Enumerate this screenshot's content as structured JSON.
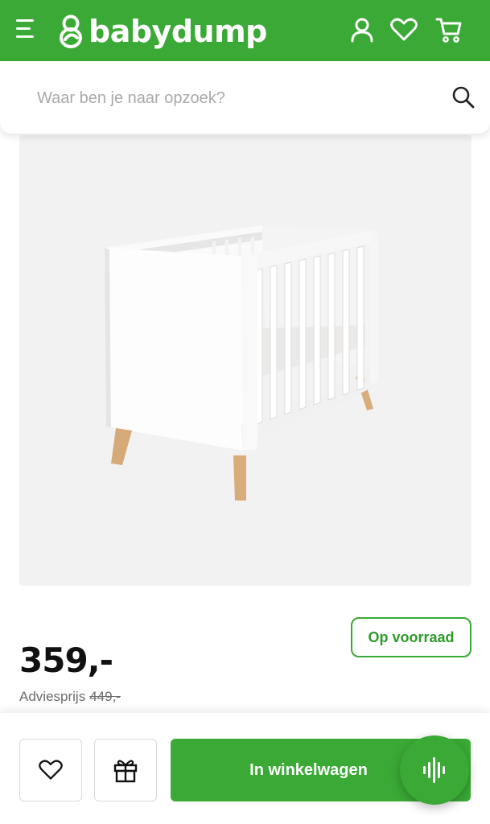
{
  "header": {
    "brand": "babydump",
    "background_color": "#3aa935",
    "icons": [
      "menu-icon",
      "user-icon",
      "heart-icon",
      "cart-icon"
    ]
  },
  "search": {
    "placeholder": "Waar ben je naar opzoek?",
    "value": ""
  },
  "product": {
    "stock_label": "Op voorraad",
    "price": "359,-",
    "advice_label": "Adviesprijs",
    "advice_price": "449,-"
  },
  "actions": {
    "cart_label": "In winkelwagen",
    "accent_color": "#3aa935"
  }
}
